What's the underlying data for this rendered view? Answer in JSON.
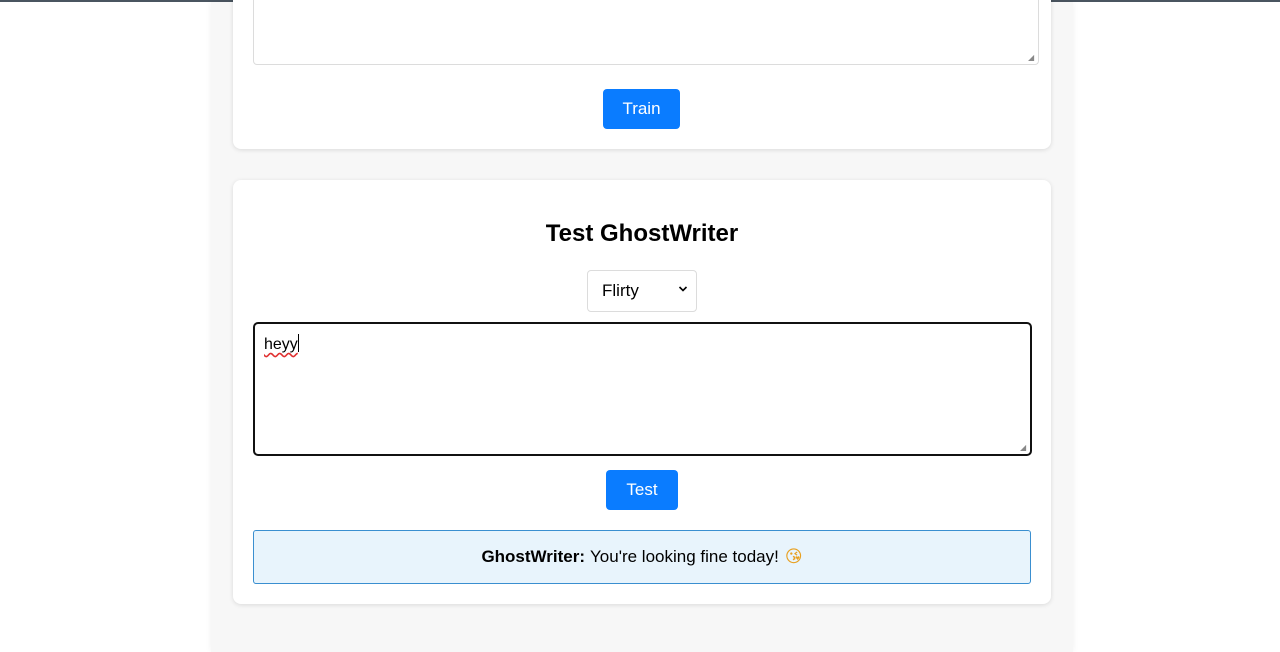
{
  "train_section": {
    "train_button_label": "Train"
  },
  "test_section": {
    "title": "Test GhostWriter",
    "tone_select": {
      "selected": "Flirty"
    },
    "input_value": "heyy",
    "test_button_label": "Test",
    "output": {
      "speaker": "GhostWriter:",
      "message": "You're looking fine today!",
      "emoji": "😘"
    }
  },
  "colors": {
    "accent": "#0a7cff",
    "output_bg": "#e8f4fc",
    "output_border": "#3a8fd0"
  }
}
